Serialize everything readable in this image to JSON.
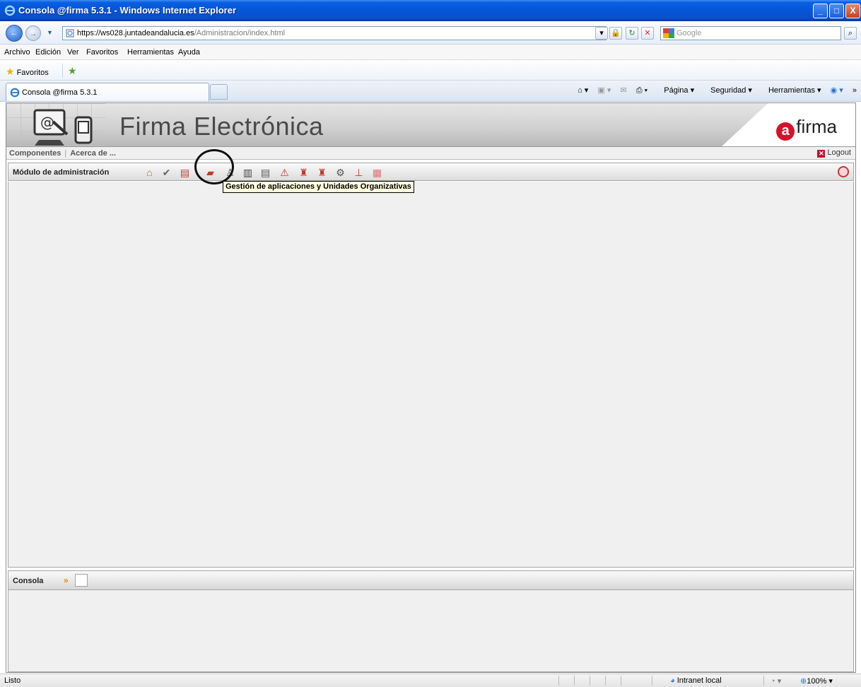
{
  "window": {
    "title": "Consola @firma 5.3.1 - Windows Internet Explorer",
    "buttons": {
      "minimize": "_",
      "maximize": "□",
      "close": "X"
    }
  },
  "address_bar": {
    "url_host": "https://ws028.juntadeandalucia.es",
    "url_path": "/Administracion/index.html",
    "search_placeholder": "Google"
  },
  "menu": [
    "Archivo",
    "Edición",
    "Ver",
    "Favoritos",
    "Herramientas",
    "Ayuda"
  ],
  "favorites_bar": {
    "label": "Favoritos"
  },
  "tabs": [
    {
      "label": "Consola @firma 5.3.1"
    }
  ],
  "command_bar": {
    "page": "Página",
    "security": "Seguridad",
    "tools": "Herramientas"
  },
  "banner": {
    "title": "Firma Electrónica",
    "brand": "firma",
    "brand_prefix": "a"
  },
  "subnav": {
    "components": "Componentes",
    "about": "Acerca de ...",
    "logout": "Logout"
  },
  "admin_module": {
    "label": "Módulo de administración",
    "tooltip": "Gestión de aplicaciones y Unidades Organizativas",
    "toolbar_icons": [
      "home-icon",
      "check-icon",
      "books-icon",
      "folder-icon",
      "user-icon",
      "cabinet-icon",
      "document-icon",
      "warning-icon",
      "stamp-icon",
      "stamp-alt-icon",
      "gear-icon",
      "hierarchy-icon",
      "report-icon"
    ]
  },
  "console": {
    "label": "Consola"
  },
  "status_bar": {
    "status": "Listo",
    "zone": "Intranet local",
    "zoom": "100%"
  },
  "colors": {
    "accent": "#d8112b",
    "title_bar": "#0555d8",
    "panel_bg": "#f0f0f0"
  }
}
